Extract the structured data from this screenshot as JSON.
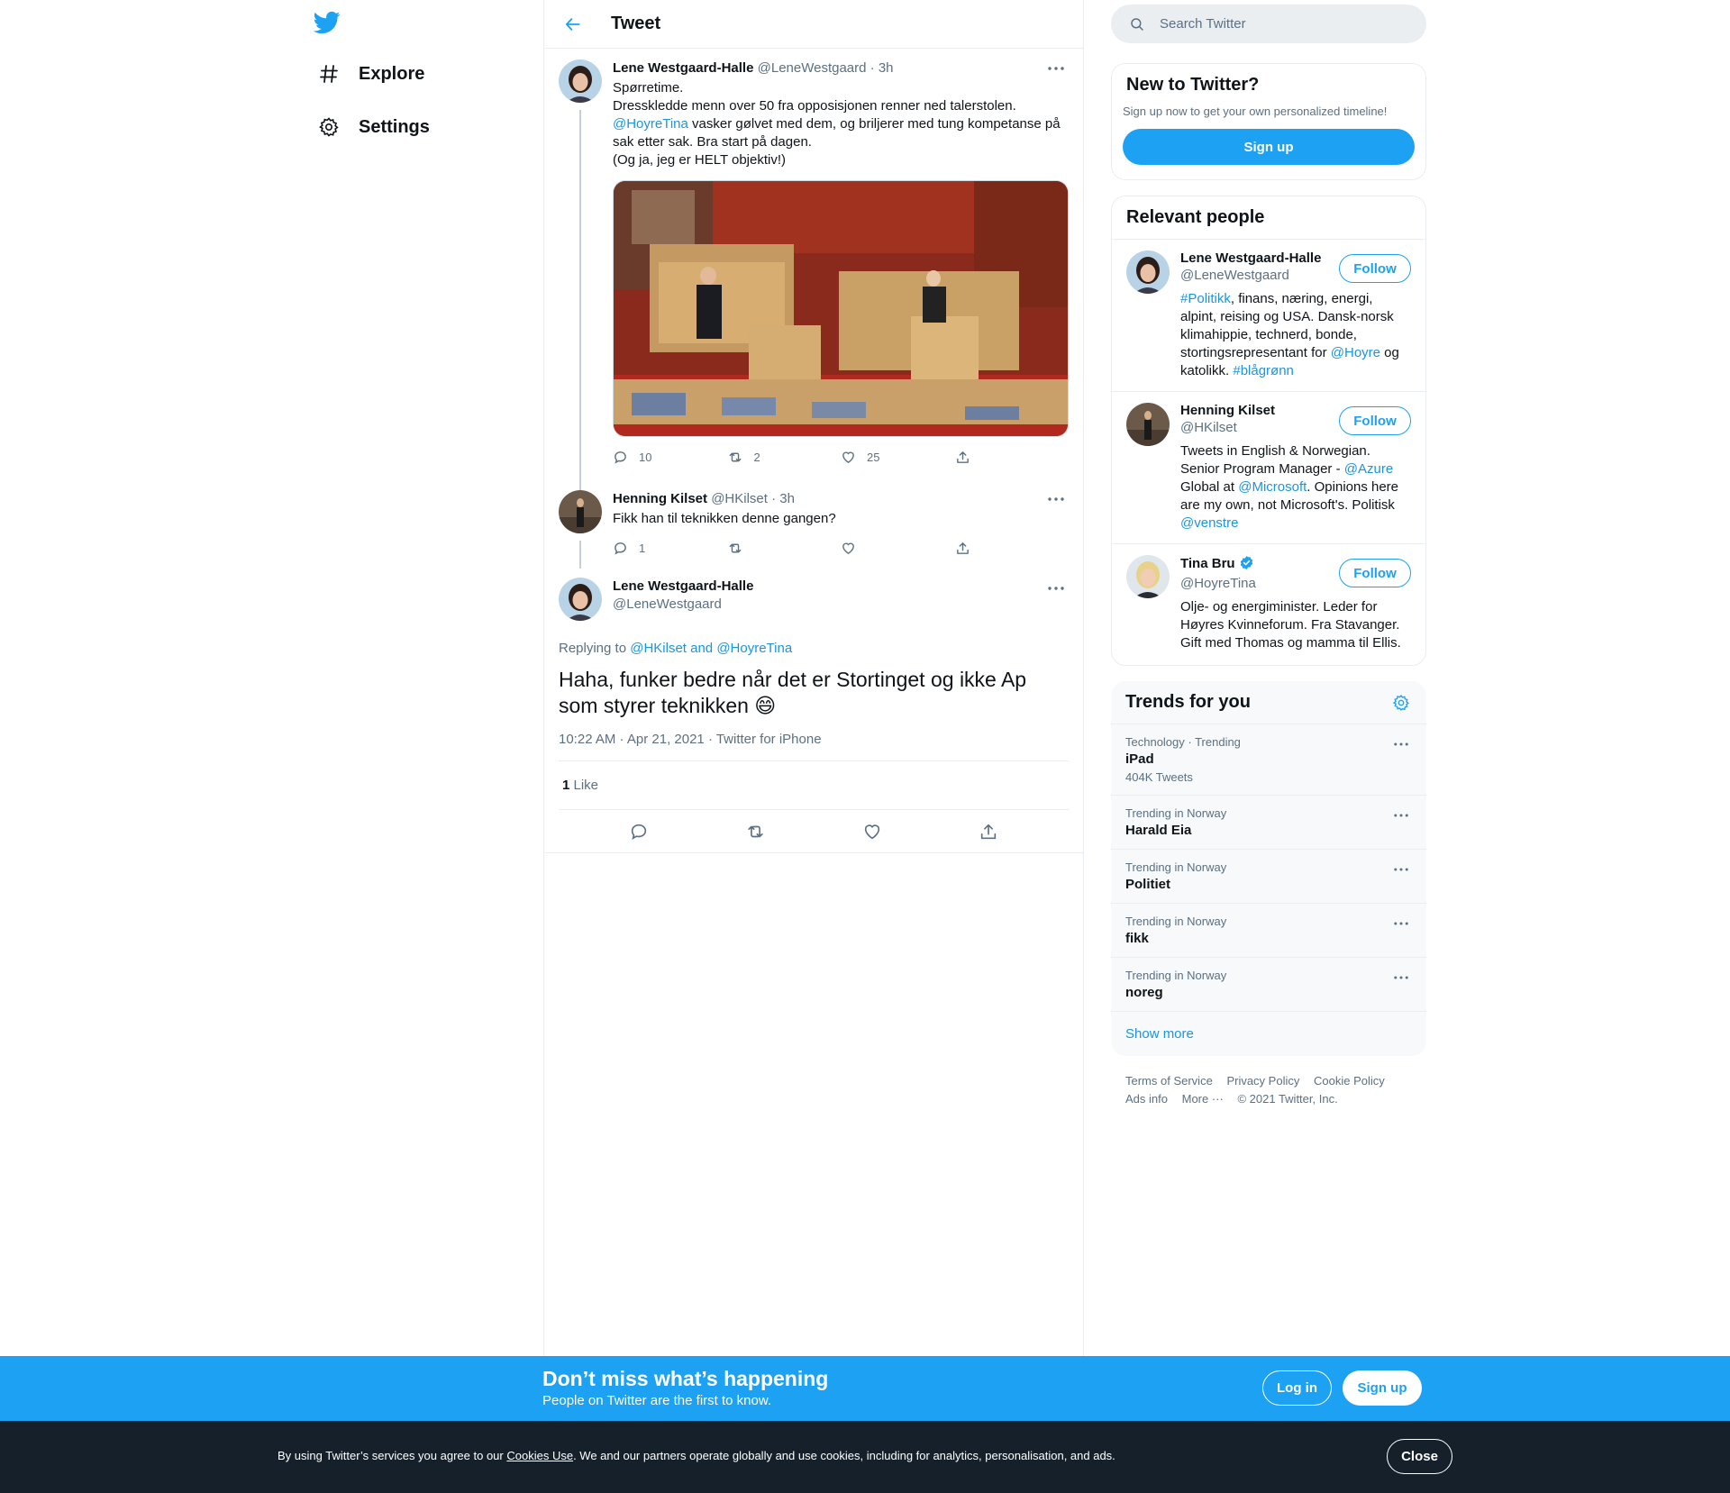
{
  "nav": {
    "logo_icon": "twitter-bird-icon",
    "items": [
      {
        "label": "Explore",
        "icon": "hashtag-icon"
      },
      {
        "label": "Settings",
        "icon": "gear-icon"
      }
    ]
  },
  "header": {
    "title": "Tweet"
  },
  "thread": [
    {
      "name": "Lene Westgaard-Halle",
      "handle": "@LeneWestgaard",
      "time": "· 3h",
      "text_lines": [
        "Spørretime.",
        "Dresskledde menn over 50 fra opposisjonen renner ned talerstolen.",
        "@HoyreTina",
        " vasker gølvet med dem, og briljerer med tung kompetanse på sak etter sak. Bra start på dagen.",
        "(Og ja, jeg er HELT objektiv!)"
      ],
      "replies": "10",
      "retweets": "2",
      "likes": "25"
    },
    {
      "name": "Henning Kilset",
      "handle": "@HKilset",
      "time": "· 3h",
      "text": "Fikk han til teknikken denne gangen?",
      "replies": "1",
      "retweets": "",
      "likes": ""
    }
  ],
  "focus": {
    "name": "Lene Westgaard-Halle",
    "handle": "@LeneWestgaard",
    "replying_prefix": "Replying to ",
    "replying_to": "@HKilset and @HoyreTina",
    "text": "Haha, funker bedre når det er Stortinget og ikke Ap som styrer teknikken 😄",
    "timestamp": "10:22 AM · Apr 21, 2021 · Twitter for iPhone",
    "like_count": "1",
    "like_label": " Like"
  },
  "search": {
    "placeholder": "Search Twitter"
  },
  "signup_card": {
    "title": "New to Twitter?",
    "subtitle": "Sign up now to get your own personalized timeline!",
    "button": "Sign up"
  },
  "people": {
    "title": "Relevant people",
    "follow_label": "Follow",
    "items": [
      {
        "name": "Lene Westgaard-Halle",
        "handle": "@LeneWestgaard",
        "bio_parts": [
          "#Politikk",
          ", finans, næring, energi, alpint, reising og USA. Dansk-norsk klimahippie, technerd, bonde, stortingsrepresentant for ",
          "@Hoyre",
          " og katolikk. ",
          "#blågrønn"
        ]
      },
      {
        "name": "Henning Kilset",
        "handle": "@HKilset",
        "bio_parts": [
          "Tweets in English & Norwegian. Senior Program Manager - ",
          "@Azure",
          " Global at ",
          "@Microsoft",
          ". Opinions here are my own, not Microsoft's. Politisk ",
          "@venstre"
        ]
      },
      {
        "name": "Tina Bru",
        "handle": "@HoyreTina",
        "verified": true,
        "bio_parts": [
          "Olje- og energiminister. Leder for Høyres Kvinneforum. Fra Stavanger. Gift med Thomas og mamma til Ellis."
        ]
      }
    ]
  },
  "trends": {
    "title": "Trends for you",
    "items": [
      {
        "context": "Technology · Trending",
        "name": "iPad",
        "count": "404K Tweets"
      },
      {
        "context": "Trending in Norway",
        "name": "Harald Eia",
        "count": ""
      },
      {
        "context": "Trending in Norway",
        "name": "Politiet",
        "count": ""
      },
      {
        "context": "Trending in Norway",
        "name": "fikk",
        "count": ""
      },
      {
        "context": "Trending in Norway",
        "name": "noreg",
        "count": ""
      }
    ],
    "show_more": "Show more"
  },
  "footer": {
    "links": [
      "Terms of Service",
      "Privacy Policy",
      "Cookie Policy",
      "Ads info",
      "More ···"
    ],
    "copyright": "© 2021 Twitter, Inc."
  },
  "bottom_bar": {
    "title": "Don’t miss what’s happening",
    "subtitle": "People on Twitter are the first to know.",
    "login": "Log in",
    "signup": "Sign up"
  },
  "cookie": {
    "before": "By using Twitter’s services you agree to our ",
    "link": "Cookies Use",
    "after": ". We and our partners operate globally and use cookies, including for analytics, personalisation, and ads.",
    "close": "Close"
  },
  "colors": {
    "accent": "#1da1f2",
    "link": "#1b95e0",
    "secondary_text": "#5b7083"
  }
}
